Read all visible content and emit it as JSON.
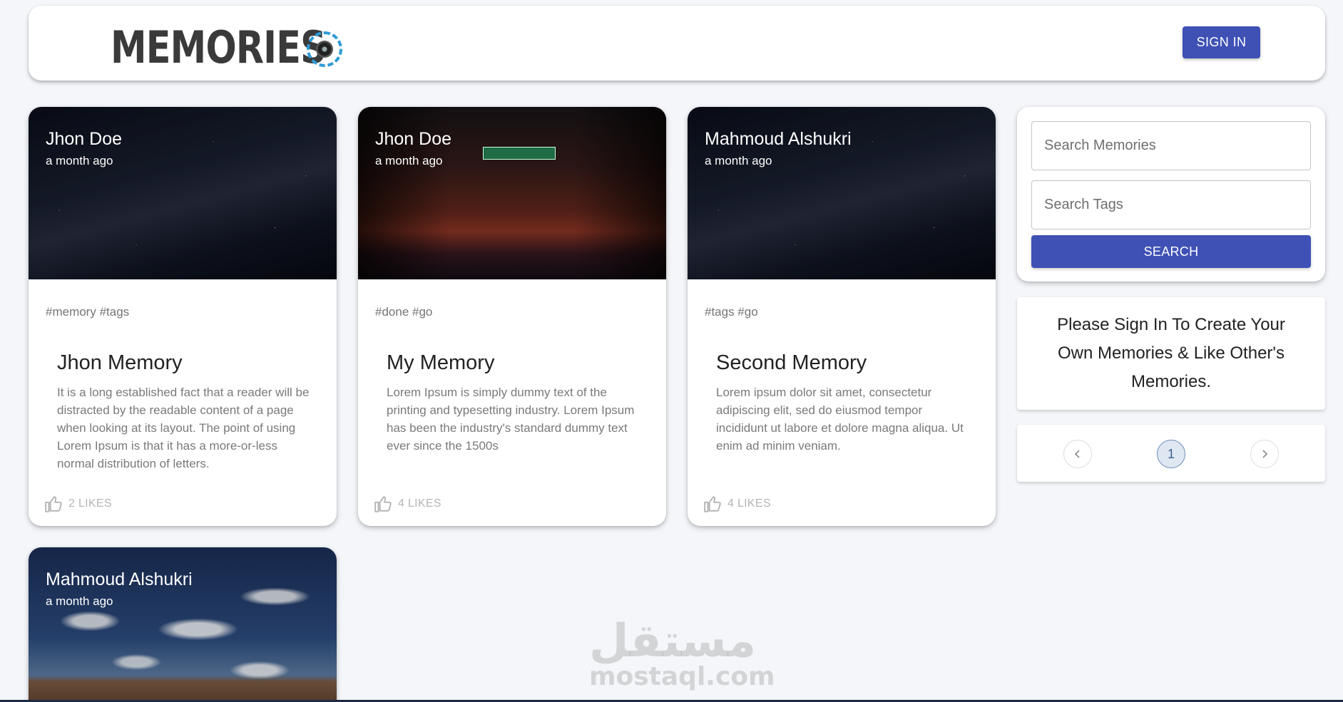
{
  "header": {
    "brand": "Memories",
    "signin_label": "Sign In"
  },
  "posts": [
    {
      "author": "Jhon Doe",
      "time": "a month ago",
      "tags": "#memory #tags",
      "title": "Jhon Memory",
      "body": "It is a long established fact that a reader will be distracted by the readable content of a page when looking at its layout. The point of using Lorem Ipsum is that it has a more-or-less normal distribution of letters.",
      "likes": "2 Likes"
    },
    {
      "author": "Jhon Doe",
      "time": "a month ago",
      "tags": "#done #go",
      "title": "My Memory",
      "body": "Lorem Ipsum is simply dummy text of the printing and typesetting industry. Lorem Ipsum has been the industry's standard dummy text ever since the 1500s",
      "likes": "4 Likes"
    },
    {
      "author": "Mahmoud Alshukri",
      "time": "a month ago",
      "tags": "#tags #go",
      "title": "Second Memory",
      "body": "Lorem ipsum dolor sit amet, consectetur adipiscing elit, sed do eiusmod tempor incididunt ut labore et dolore magna aliqua. Ut enim ad minim veniam.",
      "likes": "4 Likes"
    },
    {
      "author": "Mahmoud Alshukri",
      "time": "a month ago"
    }
  ],
  "sidebar": {
    "search_memories_placeholder": "Search Memories",
    "search_tags_placeholder": "Search Tags",
    "search_label": "Search",
    "notice": "Please Sign In To Create Your Own Memories & Like Other's Memories.",
    "current_page": "1"
  },
  "watermark": {
    "arabic": "مستقل",
    "latin": "mostaql.com"
  },
  "colors": {
    "primary": "#3f51b5",
    "background": "#f4f6fa",
    "logo_accent": "#2e9bd8"
  }
}
